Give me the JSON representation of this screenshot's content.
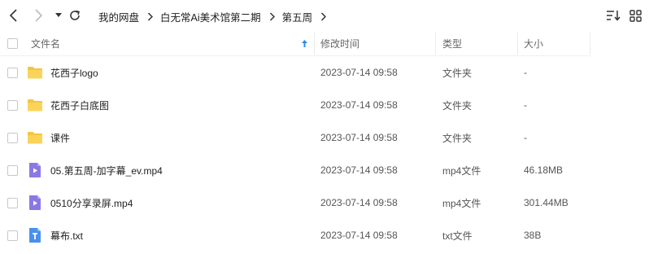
{
  "toolbar": {
    "breadcrumb": [
      "我的网盘",
      "白无常Ai美术馆第二期",
      "第五周"
    ]
  },
  "columns": {
    "name": "文件名",
    "modified": "修改时间",
    "type": "类型",
    "size": "大小"
  },
  "colors": {
    "folder": "#F5C53B",
    "video": "#8B78E6",
    "text": "#4A90F0",
    "accent": "#2B8CEB"
  },
  "files": [
    {
      "name": "花西子logo",
      "modified": "2023-07-14 09:58",
      "type": "文件夹",
      "size": "-",
      "icon": "folder-icon"
    },
    {
      "name": "花西子白底图",
      "modified": "2023-07-14 09:58",
      "type": "文件夹",
      "size": "-",
      "icon": "folder-icon"
    },
    {
      "name": "课件",
      "modified": "2023-07-14 09:58",
      "type": "文件夹",
      "size": "-",
      "icon": "folder-icon"
    },
    {
      "name": "05.第五周-加字幕_ev.mp4",
      "modified": "2023-07-14 09:58",
      "type": "mp4文件",
      "size": "46.18MB",
      "icon": "video-file-icon"
    },
    {
      "name": "0510分享录屏.mp4",
      "modified": "2023-07-14 09:58",
      "type": "mp4文件",
      "size": "301.44MB",
      "icon": "video-file-icon"
    },
    {
      "name": "幕布.txt",
      "modified": "2023-07-14 09:58",
      "type": "txt文件",
      "size": "38B",
      "icon": "text-file-icon"
    }
  ]
}
